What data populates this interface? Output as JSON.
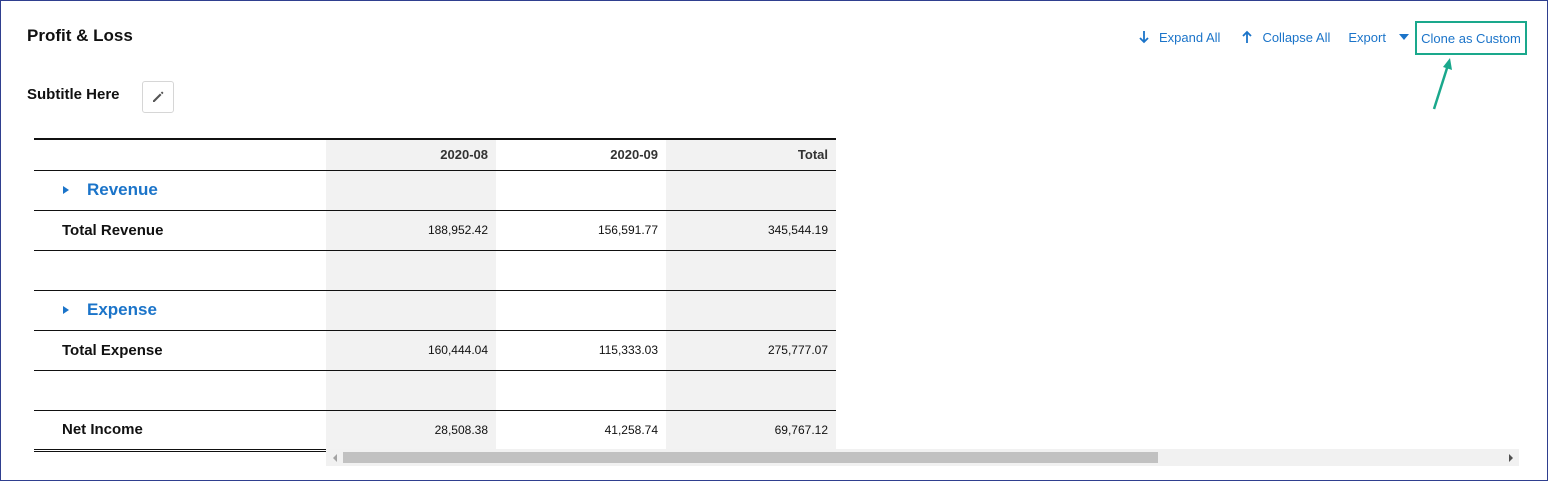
{
  "report": {
    "title": "Profit & Loss",
    "subtitle": "Subtitle Here"
  },
  "toolbar": {
    "expand_all": "Expand All",
    "collapse_all": "Collapse All",
    "export": "Export",
    "clone_as_custom": "Clone as Custom"
  },
  "icons": {
    "expand": "arrow-down-icon",
    "collapse": "arrow-up-icon",
    "export_menu": "caret-down-icon",
    "edit": "pencil-icon",
    "group_toggle": "caret-right-icon"
  },
  "colors": {
    "link": "#1b74c9",
    "highlight": "#1aa88c",
    "shade": "#f2f2f2"
  },
  "table": {
    "columns": [
      "",
      "2020-08",
      "2020-09",
      "Total"
    ],
    "rows": {
      "revenue_group": {
        "label": "Revenue"
      },
      "total_revenue": {
        "label": "Total Revenue",
        "values": [
          "188,952.42",
          "156,591.77",
          "345,544.19"
        ]
      },
      "expense_group": {
        "label": "Expense"
      },
      "total_expense": {
        "label": "Total Expense",
        "values": [
          "160,444.04",
          "115,333.03",
          "275,777.07"
        ]
      },
      "net_income": {
        "label": "Net Income",
        "values": [
          "28,508.38",
          "41,258.74",
          "69,767.12"
        ]
      }
    }
  }
}
